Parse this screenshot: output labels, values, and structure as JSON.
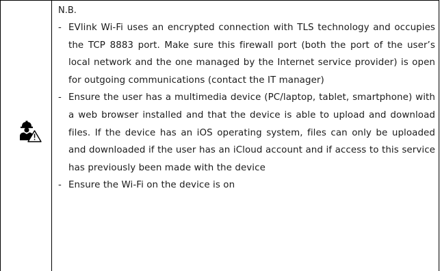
{
  "note": {
    "icon": "technician-warning-icon",
    "heading": "N.B.",
    "bullet_marker": "-",
    "items": [
      "EVlink Wi-Fi uses an encrypted connection with TLS technology and occupies the TCP 8883 port. Make sure this firewall port (both the port of the user’s local network and the one managed by the Internet service provider) is open for outgoing communications (contact the IT manager)",
      "Ensure the user has a multimedia device (PC/laptop, tablet, smartphone) with a web browser installed and that the device is able to upload and download files. If the device has an iOS operating system, files can only be uploaded and downloaded if the user has an iCloud account and if access to this service has previously been made with the device",
      "Ensure the Wi-Fi on the device is on"
    ]
  }
}
